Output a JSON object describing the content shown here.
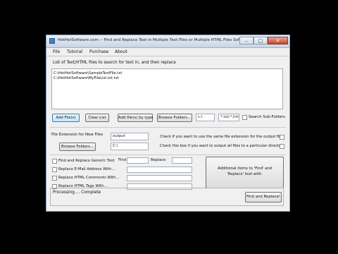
{
  "window": {
    "title": "HotHotSoftware.com -- Find and Replace Text in Multiple Text Files or Multiple HTML Files Software"
  },
  "menu": [
    "File",
    "Tutorial",
    "Purchase",
    "About"
  ],
  "files_section": {
    "label": "List of Text/HTML files to search for text in, and then replace",
    "files": [
      "C:\\HotHotSoftware\\SampleTextFile.txt",
      "C:\\HotHotSoftware\\MyFileList.txt.txt"
    ]
  },
  "file_buttons": {
    "add_files": "Add File(s)",
    "clear_list": "Clear List",
    "add_by_type": "Add file(s) by type",
    "browse_folders": "Browse Folders...",
    "folder_value": "c:\\",
    "types_value": "*.txt;*.htm;",
    "search_subfolders": "Search Sub-Folders"
  },
  "output": {
    "ext_label": "File Extension for New Files",
    "ext_value": "output",
    "browse_folders": "Browse Folders...",
    "folder_value": "C:\\",
    "check_same_ext": "Check if you want to use the same file extension for the output file",
    "check_subfolder": "Check this box if you want to output all files to a particular directory"
  },
  "options": {
    "find_label": "Find",
    "replace_label": "Replace",
    "items": [
      "Find and Replace Generic Text",
      "Replace E-Mail Address With...",
      "Replace HTML Comments With...",
      "Replace HTML Tags With..."
    ],
    "additional_button": "Additional items to 'Find' and 'Replace' text with."
  },
  "status": {
    "text": "Processing.... Complete",
    "run_button": "Find and Replace!"
  },
  "colors": {
    "background": "#000000",
    "window_face": "#f0f0f0",
    "titlebar": "#c9d5e5"
  }
}
